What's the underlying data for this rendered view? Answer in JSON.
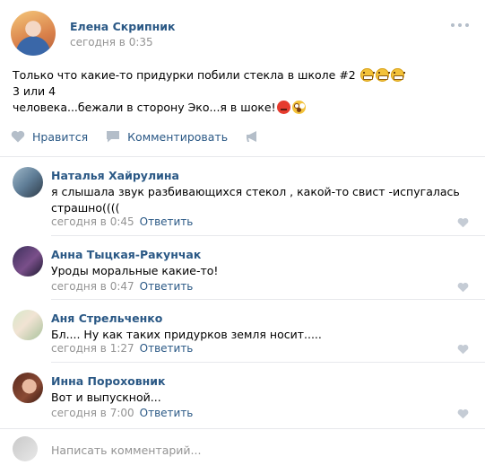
{
  "post": {
    "author": "Елена Скрипник",
    "date": "сегодня в 0:35",
    "text_line1": "Только что какие-то придурки побили стекла в школе #2",
    "text_line1_tail": " 3 или 4",
    "text_line2": "человека...бежали в сторону Эко...я в шоке!",
    "emojis_line1": [
      "grinning-face-emoji",
      "grinning-face-emoji",
      "grinning-face-emoji"
    ],
    "emojis_line2": [
      "angry-face-emoji",
      "astonished-face-emoji"
    ]
  },
  "actions": {
    "like_label": "Нравится",
    "comment_label": "Комментировать"
  },
  "comments": [
    {
      "author": "Наталья Хайрулина",
      "text": "я слышала звук разбивающихся стекол , какой-то свист -испугалась страшно((((",
      "date": "сегодня в 0:45",
      "reply_label": "Ответить"
    },
    {
      "author": "Анна Тыцкая-Ракунчак",
      "text": "Уроды моральные какие-то!",
      "date": "сегодня в 0:47",
      "reply_label": "Ответить"
    },
    {
      "author": "Аня Стрельченко",
      "text": "Бл.... Ну как таких придурков земля носит.....",
      "date": "сегодня в 1:27",
      "reply_label": "Ответить"
    },
    {
      "author": "Инна Пороховник",
      "text": "Вот и выпускной...",
      "date": "сегодня в 7:00",
      "reply_label": "Ответить"
    }
  ],
  "reply_box": {
    "placeholder": "Написать комментарий..."
  },
  "colors": {
    "link": "#2a5885",
    "meta": "#939393",
    "icon": "#b4bec9",
    "divider": "#e7e8ec"
  }
}
